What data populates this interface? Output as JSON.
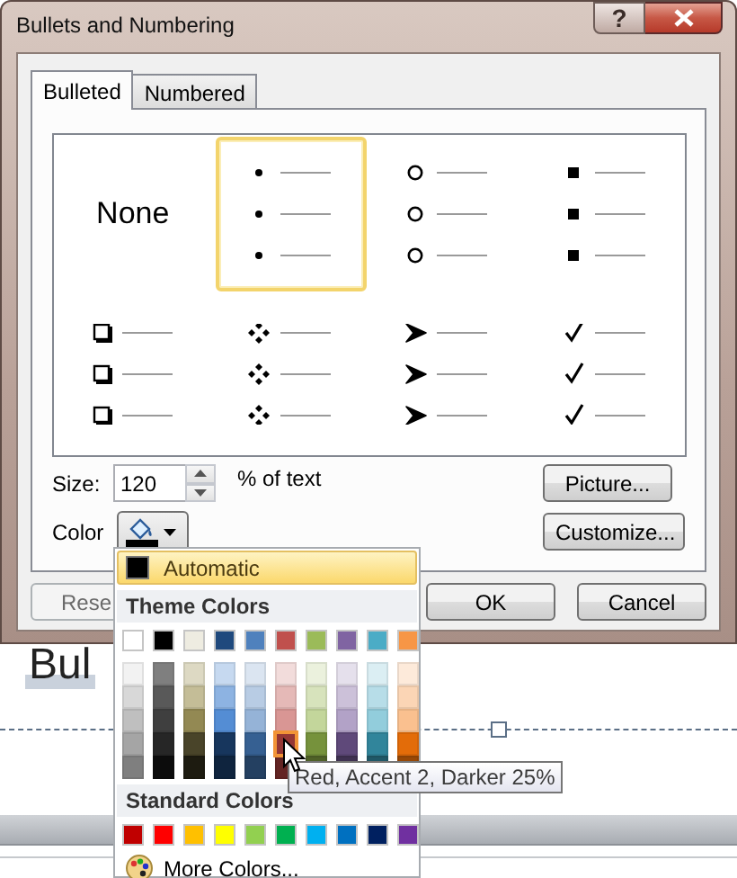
{
  "slide": {
    "text": "Bul"
  },
  "dialog": {
    "title": "Bullets and Numbering",
    "help_label": "?"
  },
  "tabs": [
    {
      "label": "Bulleted",
      "selected": true
    },
    {
      "label": "Numbered",
      "selected": false
    }
  ],
  "bullet_styles": [
    {
      "kind": "none",
      "label": "None",
      "selected": false
    },
    {
      "kind": "dot",
      "selected": true
    },
    {
      "kind": "circle",
      "selected": false
    },
    {
      "kind": "square",
      "selected": false
    },
    {
      "kind": "box",
      "selected": false
    },
    {
      "kind": "diamonds",
      "selected": false
    },
    {
      "kind": "arrowhead",
      "selected": false
    },
    {
      "kind": "check",
      "selected": false
    }
  ],
  "size": {
    "label": "Size:",
    "value": "120",
    "unit": "% of text"
  },
  "color": {
    "label": "Color"
  },
  "side_buttons": [
    "Picture...",
    "Customize..."
  ],
  "footer_buttons": [
    {
      "label": "Rese",
      "disabled": true
    },
    {
      "label": "OK",
      "disabled": false
    },
    {
      "label": "Cancel",
      "disabled": false
    }
  ],
  "color_menu": {
    "automatic": {
      "label": "Automatic",
      "color": "#000000",
      "selected": true
    },
    "theme_header": "Theme Colors",
    "theme_colors": [
      {
        "color": "#ffffff",
        "selected": false
      },
      {
        "color": "#000000",
        "selected": false
      },
      {
        "color": "#eeece1",
        "selected": false
      },
      {
        "color": "#1f497d",
        "selected": false
      },
      {
        "color": "#4f81bd",
        "selected": false
      },
      {
        "color": "#c0504d",
        "selected": false
      },
      {
        "color": "#9bbb59",
        "selected": false
      },
      {
        "color": "#8064a2",
        "selected": false
      },
      {
        "color": "#4bacc6",
        "selected": false
      },
      {
        "color": "#f79646",
        "selected": false
      }
    ],
    "theme_shades": [
      [
        {
          "color": "#f2f2f2",
          "selected": false
        },
        {
          "color": "#7f7f7f",
          "selected": false
        },
        {
          "color": "#ddd9c3",
          "selected": false
        },
        {
          "color": "#c6d9f0",
          "selected": false
        },
        {
          "color": "#dbe5f1",
          "selected": false
        },
        {
          "color": "#f2dcdb",
          "selected": false
        },
        {
          "color": "#ebf1dd",
          "selected": false
        },
        {
          "color": "#e5e0ec",
          "selected": false
        },
        {
          "color": "#dbeef3",
          "selected": false
        },
        {
          "color": "#fdeada",
          "selected": false
        }
      ],
      [
        {
          "color": "#d8d8d8",
          "selected": false
        },
        {
          "color": "#595959",
          "selected": false
        },
        {
          "color": "#c4bd97",
          "selected": false
        },
        {
          "color": "#8db3e2",
          "selected": false
        },
        {
          "color": "#b8cce4",
          "selected": false
        },
        {
          "color": "#e5b9b7",
          "selected": false
        },
        {
          "color": "#d7e3bc",
          "selected": false
        },
        {
          "color": "#ccc1d9",
          "selected": false
        },
        {
          "color": "#b7dde8",
          "selected": false
        },
        {
          "color": "#fbd5b5",
          "selected": false
        }
      ],
      [
        {
          "color": "#bfbfbf",
          "selected": false
        },
        {
          "color": "#3f3f3f",
          "selected": false
        },
        {
          "color": "#938953",
          "selected": false
        },
        {
          "color": "#548dd4",
          "selected": false
        },
        {
          "color": "#95b3d7",
          "selected": false
        },
        {
          "color": "#d99694",
          "selected": false
        },
        {
          "color": "#c3d69b",
          "selected": false
        },
        {
          "color": "#b2a2c7",
          "selected": false
        },
        {
          "color": "#92cddc",
          "selected": false
        },
        {
          "color": "#fac08f",
          "selected": false
        }
      ],
      [
        {
          "color": "#a5a5a5",
          "selected": false
        },
        {
          "color": "#262626",
          "selected": false
        },
        {
          "color": "#494429",
          "selected": false
        },
        {
          "color": "#17365d",
          "selected": false
        },
        {
          "color": "#366092",
          "selected": false
        },
        {
          "color": "#953734",
          "selected": true
        },
        {
          "color": "#76923c",
          "selected": false
        },
        {
          "color": "#5f497a",
          "selected": false
        },
        {
          "color": "#31859b",
          "selected": false
        },
        {
          "color": "#e36c09",
          "selected": false
        }
      ],
      [
        {
          "color": "#7f7f7f",
          "selected": false
        },
        {
          "color": "#0c0c0c",
          "selected": false
        },
        {
          "color": "#1d1b10",
          "selected": false
        },
        {
          "color": "#0f243e",
          "selected": false
        },
        {
          "color": "#244061",
          "selected": false
        },
        {
          "color": "#632423",
          "selected": false
        },
        {
          "color": "#4f6128",
          "selected": false
        },
        {
          "color": "#3f3151",
          "selected": false
        },
        {
          "color": "#205867",
          "selected": false
        },
        {
          "color": "#974806",
          "selected": false
        }
      ]
    ],
    "standard_header": "Standard Colors",
    "standard_colors": [
      {
        "color": "#c00000",
        "selected": false
      },
      {
        "color": "#ff0000",
        "selected": false
      },
      {
        "color": "#ffc000",
        "selected": false
      },
      {
        "color": "#ffff00",
        "selected": false
      },
      {
        "color": "#92d050",
        "selected": false
      },
      {
        "color": "#00b050",
        "selected": false
      },
      {
        "color": "#00b0f0",
        "selected": false
      },
      {
        "color": "#0070c0",
        "selected": false
      },
      {
        "color": "#002060",
        "selected": false
      },
      {
        "color": "#7030a0",
        "selected": false
      }
    ],
    "more_colors": "More Colors..."
  },
  "tooltip": "Red, Accent 2, Darker 25%"
}
